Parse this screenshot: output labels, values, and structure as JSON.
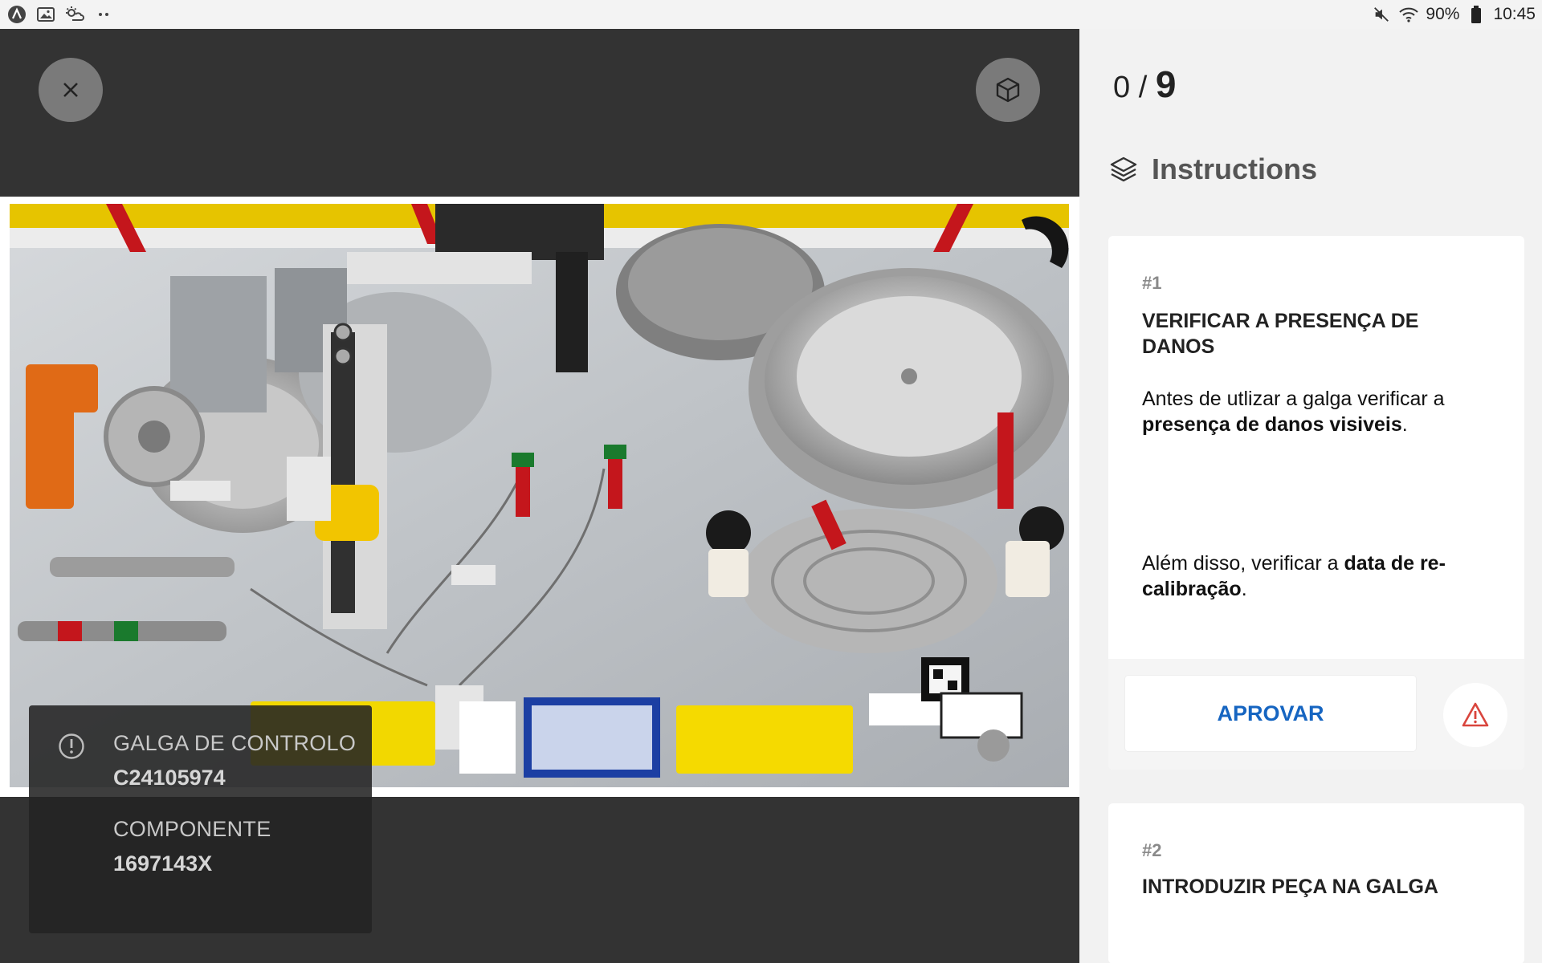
{
  "status_bar": {
    "battery_text": "90%",
    "time": "10:45"
  },
  "viewer": {
    "info": {
      "gauge_label": "GALGA DE CONTROLO",
      "gauge_value": "C24105974",
      "component_label": "COMPONENTE",
      "component_value": "1697143X"
    }
  },
  "panel": {
    "counter_current": "0 / ",
    "counter_total": "9",
    "instructions_title": "Instructions",
    "steps": [
      {
        "number": "#1",
        "title": "VERIFICAR A PRESENÇA DE DANOS",
        "paragraph1_plain": "Antes de utlizar a galga verificar a ",
        "paragraph1_bold": "presença de danos visiveis",
        "paragraph1_end": ".",
        "paragraph2_plain": "Além disso, verificar a ",
        "paragraph2_bold": "data de re-calibração",
        "paragraph2_end": ".",
        "approve_label": "APROVAR"
      },
      {
        "number": "#2",
        "title": "INTRODUZIR PEÇA NA GALGA"
      }
    ]
  },
  "icons": {
    "close": "close-icon",
    "ar": "cube-icon",
    "layers": "layers-icon",
    "warning": "warning-icon",
    "info": "info-icon"
  },
  "colors": {
    "accent_blue": "#1665c1",
    "warning_red": "#d9453d",
    "viewer_bg": "#333333"
  }
}
